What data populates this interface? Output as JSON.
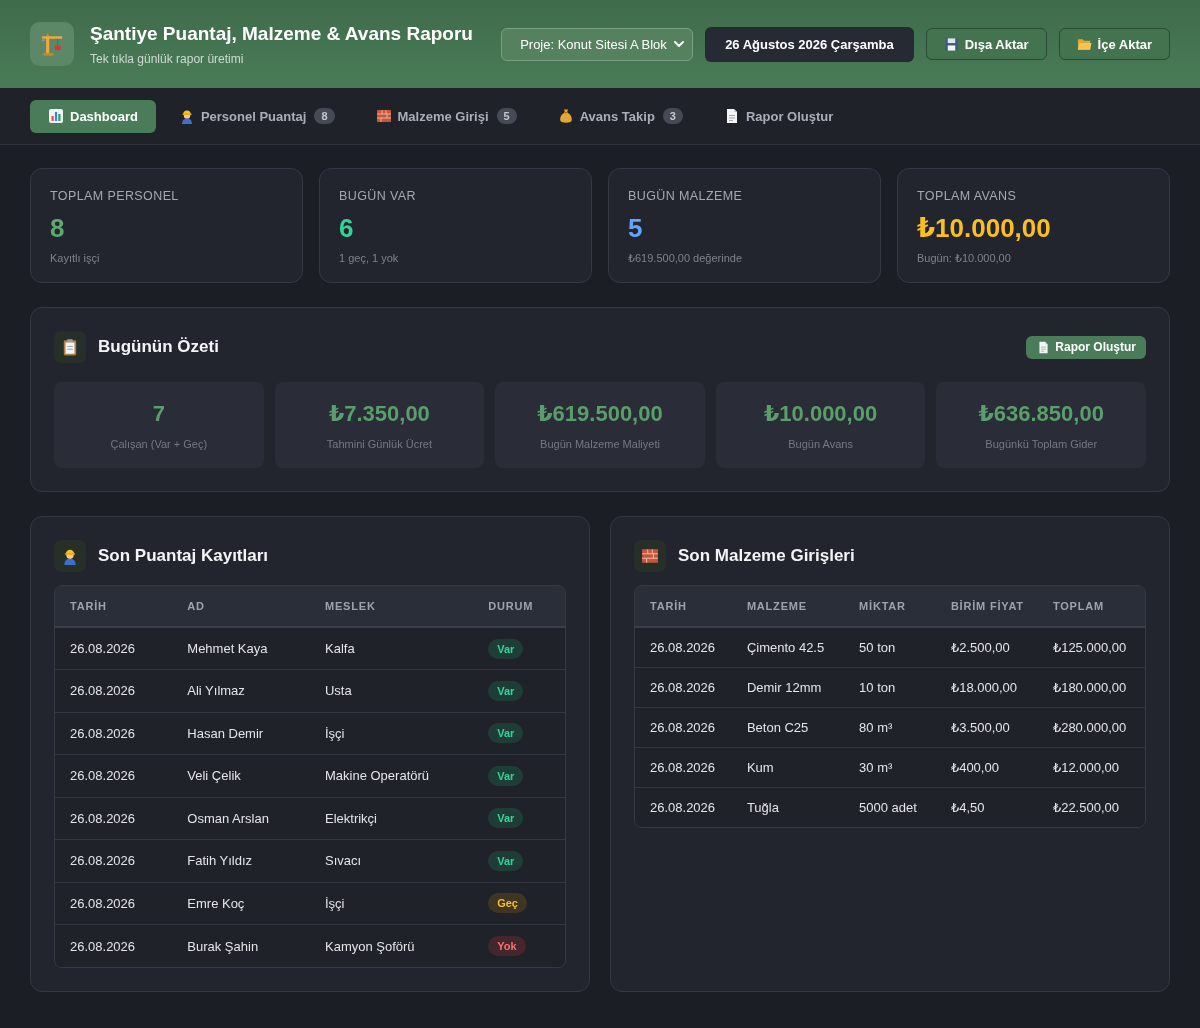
{
  "header": {
    "title": "Şantiye Puantaj, Malzeme & Avans Raporu",
    "subtitle": "Tek tıkla günlük rapor üretimi",
    "project_select": {
      "value": "Proje: Konut Sitesi A Blok"
    },
    "date": "26 Ağustos 2026 Çarşamba",
    "buttons": [
      "Dışa Aktar",
      "İçe Aktar"
    ]
  },
  "tabs": [
    {
      "label": "Dashboard",
      "selected": true
    },
    {
      "label": "Personel Puantaj",
      "count": "8",
      "selected": false
    },
    {
      "label": "Malzeme Girişi",
      "count": "5",
      "selected": false
    },
    {
      "label": "Avans Takip",
      "count": "3",
      "selected": false
    },
    {
      "label": "Rapor Oluştur",
      "selected": false
    }
  ],
  "stats": [
    {
      "label": "TOPLAM PERSONEL",
      "value": "8",
      "note": "Kayıtlı işçi",
      "color": "#5fa86f"
    },
    {
      "label": "BUGÜN VAR",
      "value": "6",
      "note": "1 geç, 1 yok",
      "color": "#34d399"
    },
    {
      "label": "BUGÜN MALZEME",
      "value": "5",
      "note": "₺619.500,00 değerinde",
      "color": "#60a5fa"
    },
    {
      "label": "TOPLAM AVANS",
      "value": "₺10.000,00",
      "note": "Bugün: ₺10.000,00",
      "color": "#fbbf24"
    }
  ],
  "summary": {
    "title": "Bugünün Özeti",
    "button": "Rapor Oluştur",
    "tiles": [
      {
        "value": "7",
        "label": "Çalışan (Var + Geç)"
      },
      {
        "value": "₺7.350,00",
        "label": "Tahmini Günlük Ücret"
      },
      {
        "value": "₺619.500,00",
        "label": "Bugün Malzeme Maliyeti"
      },
      {
        "value": "₺10.000,00",
        "label": "Bugün Avans"
      },
      {
        "value": "₺636.850,00",
        "label": "Bugünkü Toplam Gider"
      }
    ]
  },
  "attendance": {
    "title": "Son Puantaj Kayıtları",
    "columns": [
      "TARİH",
      "AD",
      "MESLEK",
      "DURUM"
    ],
    "rows": [
      {
        "date": "26.08.2026",
        "name": "Mehmet Kaya",
        "job": "Kalfa",
        "status": {
          "label": "Var",
          "kind": "present"
        }
      },
      {
        "date": "26.08.2026",
        "name": "Ali Yılmaz",
        "job": "Usta",
        "status": {
          "label": "Var",
          "kind": "present"
        }
      },
      {
        "date": "26.08.2026",
        "name": "Hasan Demir",
        "job": "İşçi",
        "status": {
          "label": "Var",
          "kind": "present"
        }
      },
      {
        "date": "26.08.2026",
        "name": "Veli Çelik",
        "job": "Makine Operatörü",
        "status": {
          "label": "Var",
          "kind": "present"
        }
      },
      {
        "date": "26.08.2026",
        "name": "Osman Arslan",
        "job": "Elektrikçi",
        "status": {
          "label": "Var",
          "kind": "present"
        }
      },
      {
        "date": "26.08.2026",
        "name": "Fatih Yıldız",
        "job": "Sıvacı",
        "status": {
          "label": "Var",
          "kind": "present"
        }
      },
      {
        "date": "26.08.2026",
        "name": "Emre Koç",
        "job": "İşçi",
        "status": {
          "label": "Geç",
          "kind": "late"
        }
      },
      {
        "date": "26.08.2026",
        "name": "Burak Şahin",
        "job": "Kamyon Şoförü",
        "status": {
          "label": "Yok",
          "kind": "absent"
        }
      }
    ]
  },
  "materials": {
    "title": "Son Malzeme Girişleri",
    "columns": [
      "TARİH",
      "MALZEME",
      "MİKTAR",
      "BİRİM FİYAT",
      "TOPLAM"
    ],
    "rows": [
      [
        "26.08.2026",
        "Çimento 42.5",
        "50 ton",
        "₺2.500,00",
        "₺125.000,00"
      ],
      [
        "26.08.2026",
        "Demir 12mm",
        "10 ton",
        "₺18.000,00",
        "₺180.000,00"
      ],
      [
        "26.08.2026",
        "Beton C25",
        "80 m³",
        "₺3.500,00",
        "₺280.000,00"
      ],
      [
        "26.08.2026",
        "Kum",
        "30 m³",
        "₺400,00",
        "₺12.000,00"
      ],
      [
        "26.08.2026",
        "Tuğla",
        "5000 adet",
        "₺4,50",
        "₺22.500,00"
      ]
    ]
  }
}
